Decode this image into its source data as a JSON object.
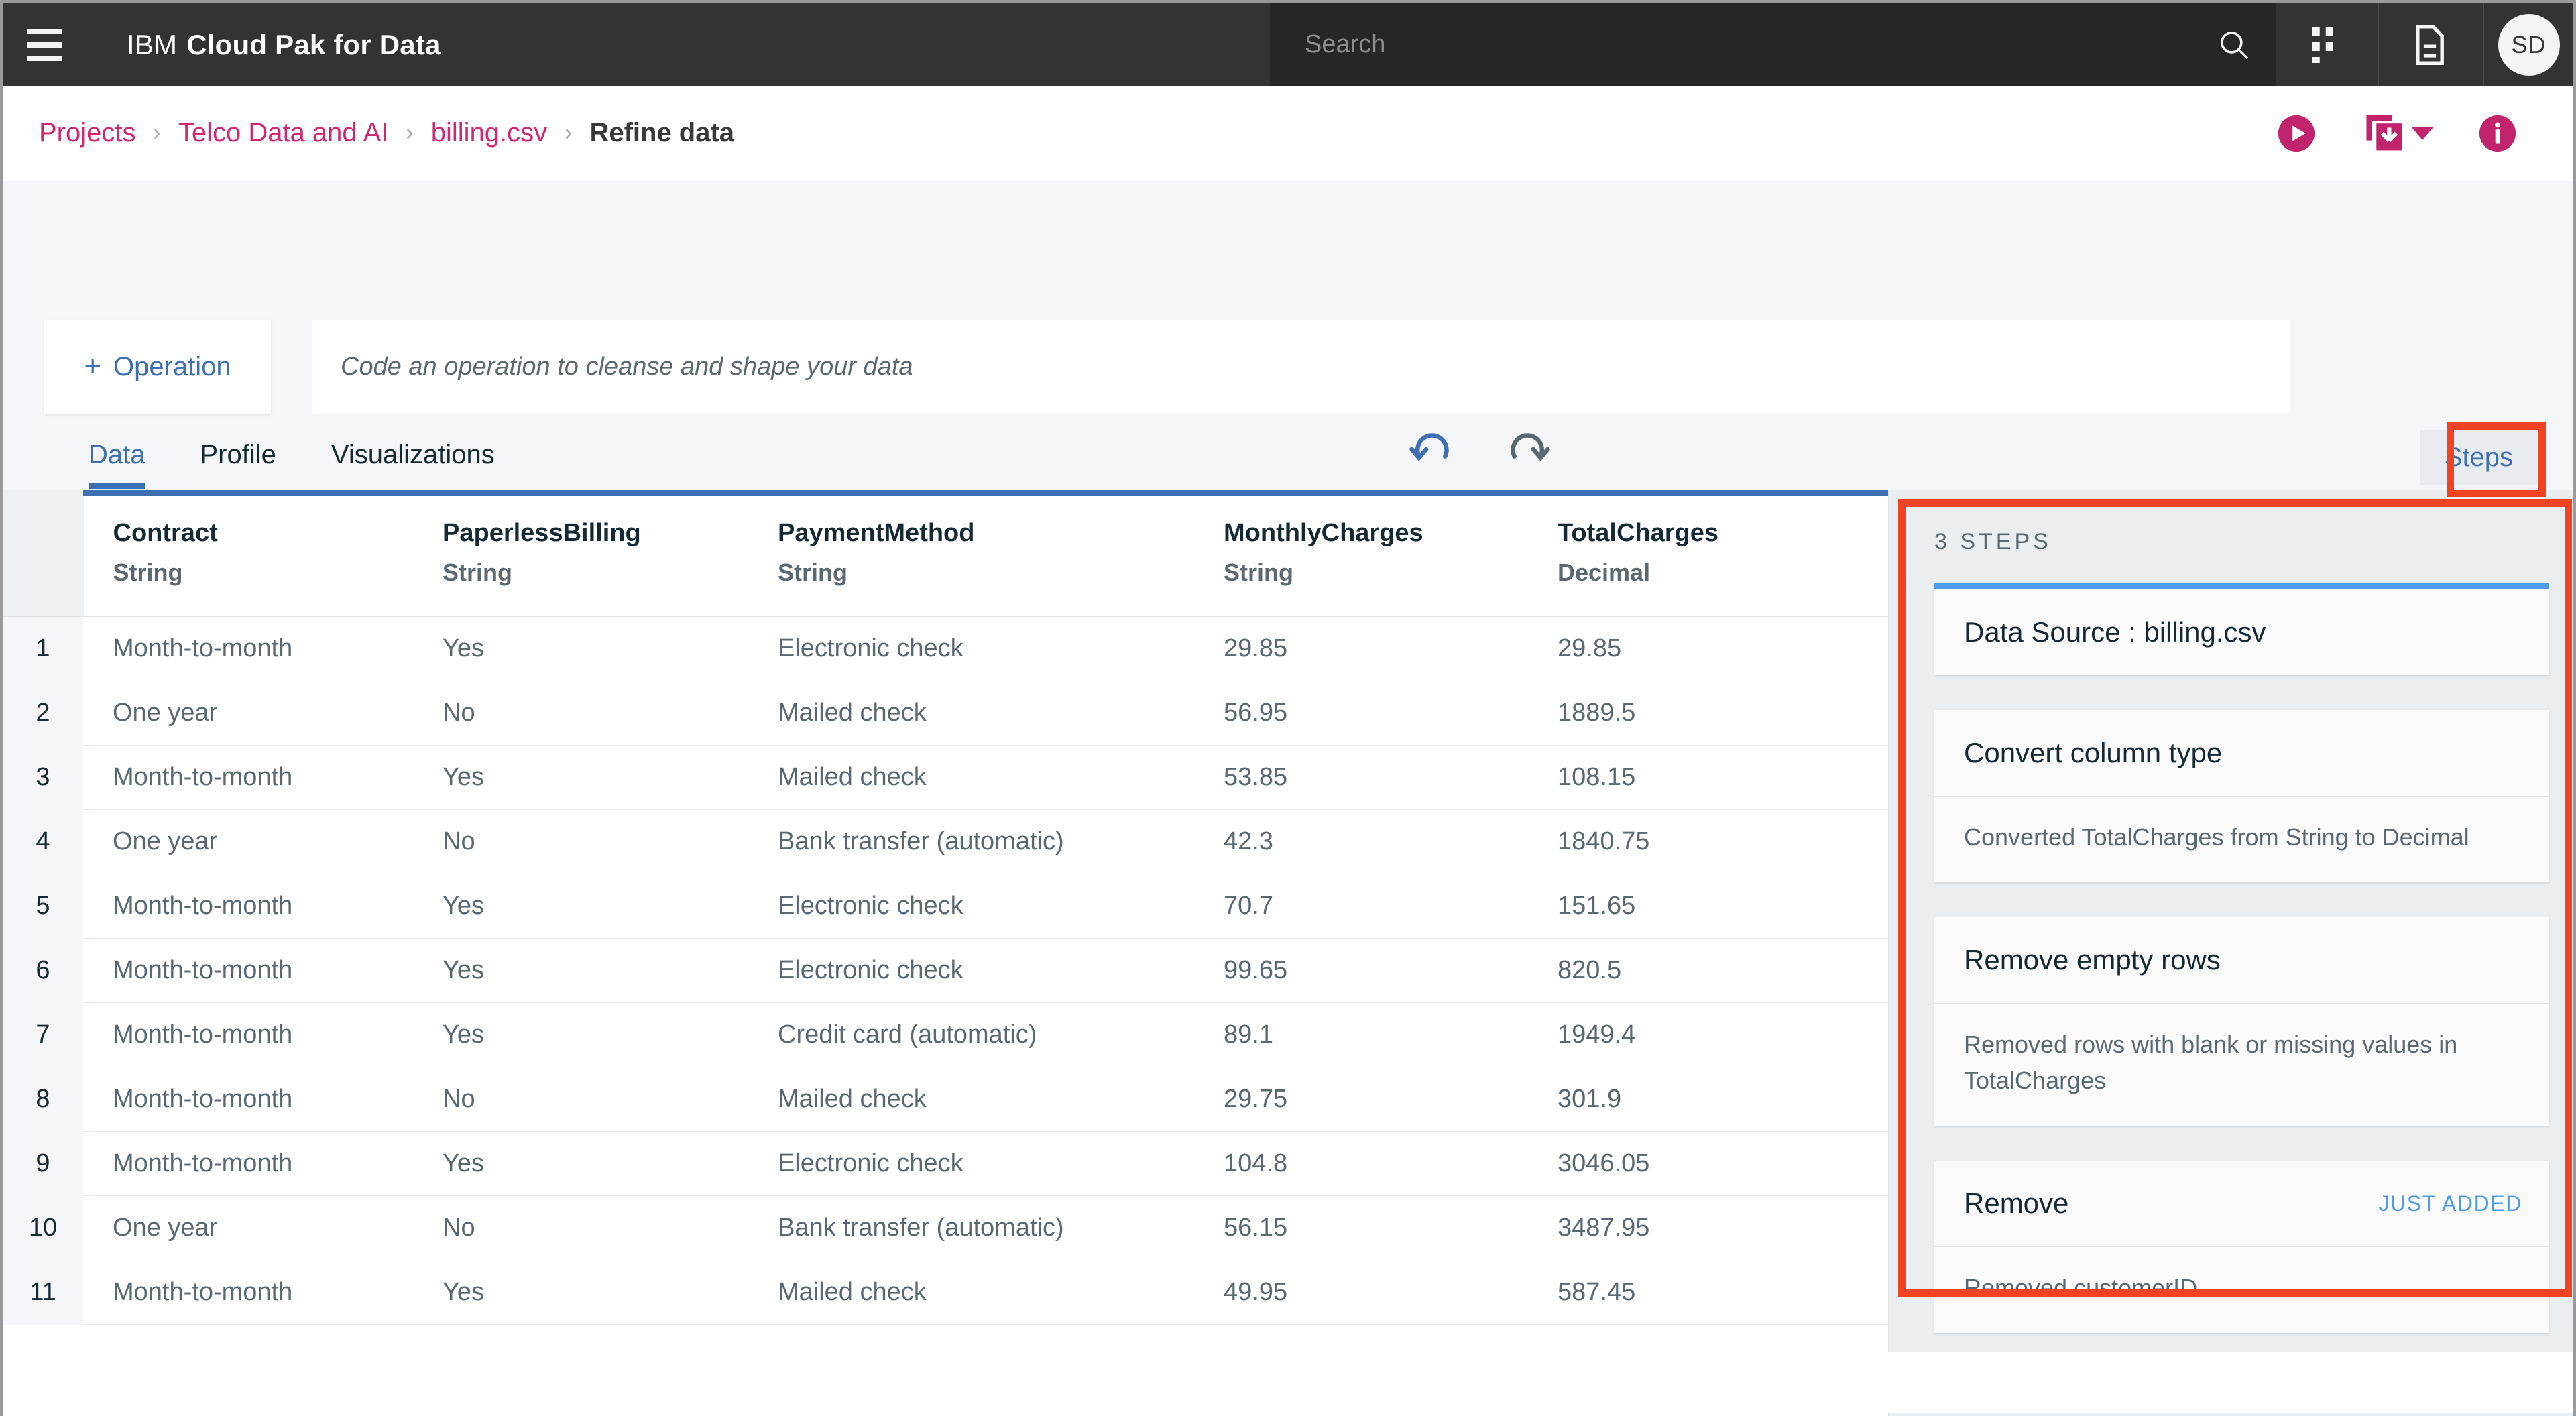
{
  "header": {
    "menu_icon": "hamburger-menu-icon",
    "brand_light": "IBM",
    "brand_bold": "Cloud Pak for Data",
    "search_placeholder": "Search",
    "search_value": "",
    "search_icon": "search-icon",
    "apps_icon": "app-switcher-icon",
    "docs_icon": "document-icon",
    "avatar_initials": "SD"
  },
  "breadcrumb": {
    "items": [
      {
        "label": "Projects",
        "current": false
      },
      {
        "label": "Telco Data and AI",
        "current": false
      },
      {
        "label": "billing.csv",
        "current": false
      },
      {
        "label": "Refine data",
        "current": true
      }
    ],
    "separator": "›",
    "actions": [
      {
        "name": "run-job-button",
        "icon": "play-circle-icon"
      },
      {
        "name": "save-flow-button",
        "icon": "save-copy-download-icon"
      },
      {
        "name": "info-button",
        "icon": "info-circle-icon"
      }
    ]
  },
  "toolbar": {
    "operation_plus": "+",
    "operation_label": "Operation",
    "code_placeholder": "Code an operation to cleanse and shape your data",
    "code_value": ""
  },
  "tabs": [
    {
      "label": "Data",
      "active": true
    },
    {
      "label": "Profile",
      "active": false
    },
    {
      "label": "Visualizations",
      "active": false
    }
  ],
  "history": {
    "undo_icon": "undo-icon",
    "redo_icon": "redo-icon"
  },
  "steps_toggle_label": "Steps",
  "table": {
    "row_number_header": "",
    "columns": [
      {
        "name": "Contract",
        "type": "String"
      },
      {
        "name": "PaperlessBilling",
        "type": "String"
      },
      {
        "name": "PaymentMethod",
        "type": "String"
      },
      {
        "name": "MonthlyCharges",
        "type": "String"
      },
      {
        "name": "TotalCharges",
        "type": "Decimal"
      }
    ],
    "rows": [
      {
        "n": "1",
        "cells": [
          "Month-to-month",
          "Yes",
          "Electronic check",
          "29.85",
          "29.85"
        ]
      },
      {
        "n": "2",
        "cells": [
          "One year",
          "No",
          "Mailed check",
          "56.95",
          "1889.5"
        ]
      },
      {
        "n": "3",
        "cells": [
          "Month-to-month",
          "Yes",
          "Mailed check",
          "53.85",
          "108.15"
        ]
      },
      {
        "n": "4",
        "cells": [
          "One year",
          "No",
          "Bank transfer (automatic)",
          "42.3",
          "1840.75"
        ]
      },
      {
        "n": "5",
        "cells": [
          "Month-to-month",
          "Yes",
          "Electronic check",
          "70.7",
          "151.65"
        ]
      },
      {
        "n": "6",
        "cells": [
          "Month-to-month",
          "Yes",
          "Electronic check",
          "99.65",
          "820.5"
        ]
      },
      {
        "n": "7",
        "cells": [
          "Month-to-month",
          "Yes",
          "Credit card (automatic)",
          "89.1",
          "1949.4"
        ]
      },
      {
        "n": "8",
        "cells": [
          "Month-to-month",
          "No",
          "Mailed check",
          "29.75",
          "301.9"
        ]
      },
      {
        "n": "9",
        "cells": [
          "Month-to-month",
          "Yes",
          "Electronic check",
          "104.8",
          "3046.05"
        ]
      },
      {
        "n": "10",
        "cells": [
          "One year",
          "No",
          "Bank transfer (automatic)",
          "56.15",
          "3487.95"
        ]
      },
      {
        "n": "11",
        "cells": [
          "Month-to-month",
          "Yes",
          "Mailed check",
          "49.95",
          "587.45"
        ]
      }
    ]
  },
  "steps": {
    "title": "3 STEPS",
    "items": [
      {
        "title": "Data Source : billing.csv",
        "description": "",
        "badge": "",
        "first": true
      },
      {
        "title": "Convert column type",
        "description": "Converted TotalCharges from String to Decimal",
        "badge": "",
        "first": false
      },
      {
        "title": "Remove empty rows",
        "description": "Removed rows with blank or missing values in TotalCharges",
        "badge": "",
        "first": false
      },
      {
        "title": "Remove",
        "description": "Removed customerID",
        "badge": "JUST ADDED",
        "first": false
      }
    ]
  },
  "colors": {
    "header_bg": "#333333",
    "search_bg": "#262626",
    "brand_pink": "#d12771",
    "accent_blue": "#3d70b2",
    "badge_blue": "#4f9bec",
    "annotation_red": "#ef4323",
    "canvas_bg": "#f4f6f9",
    "panel_bg": "#eaeef1"
  }
}
